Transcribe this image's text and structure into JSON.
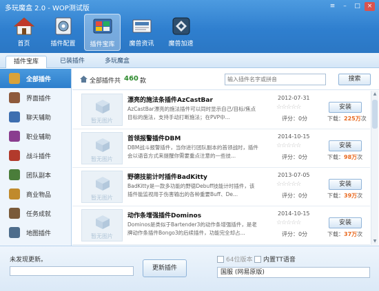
{
  "app": {
    "title": "多玩魔盒 2.0 - WOP测试版"
  },
  "window_buttons": [
    "menu",
    "minimize",
    "maximize",
    "close"
  ],
  "toolbar": {
    "items": [
      {
        "label": "首页",
        "icon": "home-icon",
        "active": false
      },
      {
        "label": "插件配置",
        "icon": "plugin-config-icon",
        "active": false
      },
      {
        "label": "插件宝库",
        "icon": "plugin-store-icon",
        "active": true
      },
      {
        "label": "魔兽资讯",
        "icon": "news-icon",
        "active": false
      },
      {
        "label": "魔兽加速",
        "icon": "accelerator-icon",
        "active": false
      }
    ]
  },
  "tabs": [
    {
      "label": "插件宝库",
      "active": true
    },
    {
      "label": "已装插件",
      "active": false
    },
    {
      "label": "多玩魔盒",
      "active": false
    }
  ],
  "sidebar": {
    "items": [
      {
        "label": "全部插件",
        "active": true,
        "color": "#d9a23a"
      },
      {
        "label": "界面插件",
        "active": false,
        "color": "#8e5a3c"
      },
      {
        "label": "聊天辅助",
        "active": false,
        "color": "#3e6fb0"
      },
      {
        "label": "职业辅助",
        "active": false,
        "color": "#8a3d8f"
      },
      {
        "label": "战斗插件",
        "active": false,
        "color": "#b23a2c"
      },
      {
        "label": "团队副本",
        "active": false,
        "color": "#4a7d3a"
      },
      {
        "label": "商业物品",
        "active": false,
        "color": "#c08a2c"
      },
      {
        "label": "任务成就",
        "active": false,
        "color": "#7a5b3a"
      },
      {
        "label": "地图插件",
        "active": false,
        "color": "#4e6d8c"
      }
    ]
  },
  "main": {
    "all_label": "全部插件共",
    "total_count": "460",
    "count_unit": "款",
    "search_placeholder": "输入插件名字或拼音",
    "search_button": "搜索"
  },
  "plugins": [
    {
      "name": "漂亮的施法条插件AzCastBar",
      "desc": "AzCastBar漂亮的施法插件可以同时显示自己/目标/焦点目标的施法，支持手动打断施法；在PVP中...",
      "date": "2012-07-31",
      "rating": 0,
      "score_label": "评分：",
      "score": "0分",
      "install_label": "安装",
      "downloads_label": "下载：",
      "downloads": "225万",
      "downloads_unit": "次",
      "no_image": "暂无图片"
    },
    {
      "name": "首领报警插件DBM",
      "desc": "DBM战斗报警插件，当你进行团队副本的首领战时，插件会以语音方式来提醒你需要重点注意的一些技...",
      "date": "2014-10-15",
      "rating": 0,
      "score_label": "评分：",
      "score": "0分",
      "install_label": "安装",
      "downloads_label": "下载：",
      "downloads": "98万",
      "downloads_unit": "次",
      "no_image": "暂无图片"
    },
    {
      "name": "野德技能计时插件BadKitty",
      "desc": "BadKitty是一款多功能的野德Debuff技能计时插件，该插件能监视用于伤害输出的各种重要Buff、De...",
      "date": "2013-07-05",
      "rating": 0,
      "score_label": "评分：",
      "score": "0分",
      "install_label": "安装",
      "downloads_label": "下载：",
      "downloads": "39万",
      "downloads_unit": "次",
      "no_image": "暂无图片"
    },
    {
      "name": "动作条增强插件Dominos",
      "desc": "Dominos是类似于Bartender3的动作条增强插件，是老牌动作条插件Bongo3的后续插件，功能完全却占...",
      "date": "2014-10-15",
      "rating": 0,
      "score_label": "评分：",
      "score": "0分",
      "install_label": "安装",
      "downloads_label": "下载：",
      "downloads": "37万",
      "downloads_unit": "次",
      "no_image": "暂无图片"
    }
  ],
  "bottom": {
    "status": "未发现更新。",
    "progress": 0,
    "update_button": "更新插件",
    "checkbox_64bit": {
      "label": "64位版本",
      "checked": false,
      "disabled": true
    },
    "checkbox_tt": {
      "label": "内置TT语音",
      "checked": false,
      "disabled": false
    },
    "server": "国服 (网易原版)"
  },
  "colors": {
    "accent": "#2f7fcf",
    "count_green": "#2e8b2e",
    "download_orange": "#e8681e"
  }
}
